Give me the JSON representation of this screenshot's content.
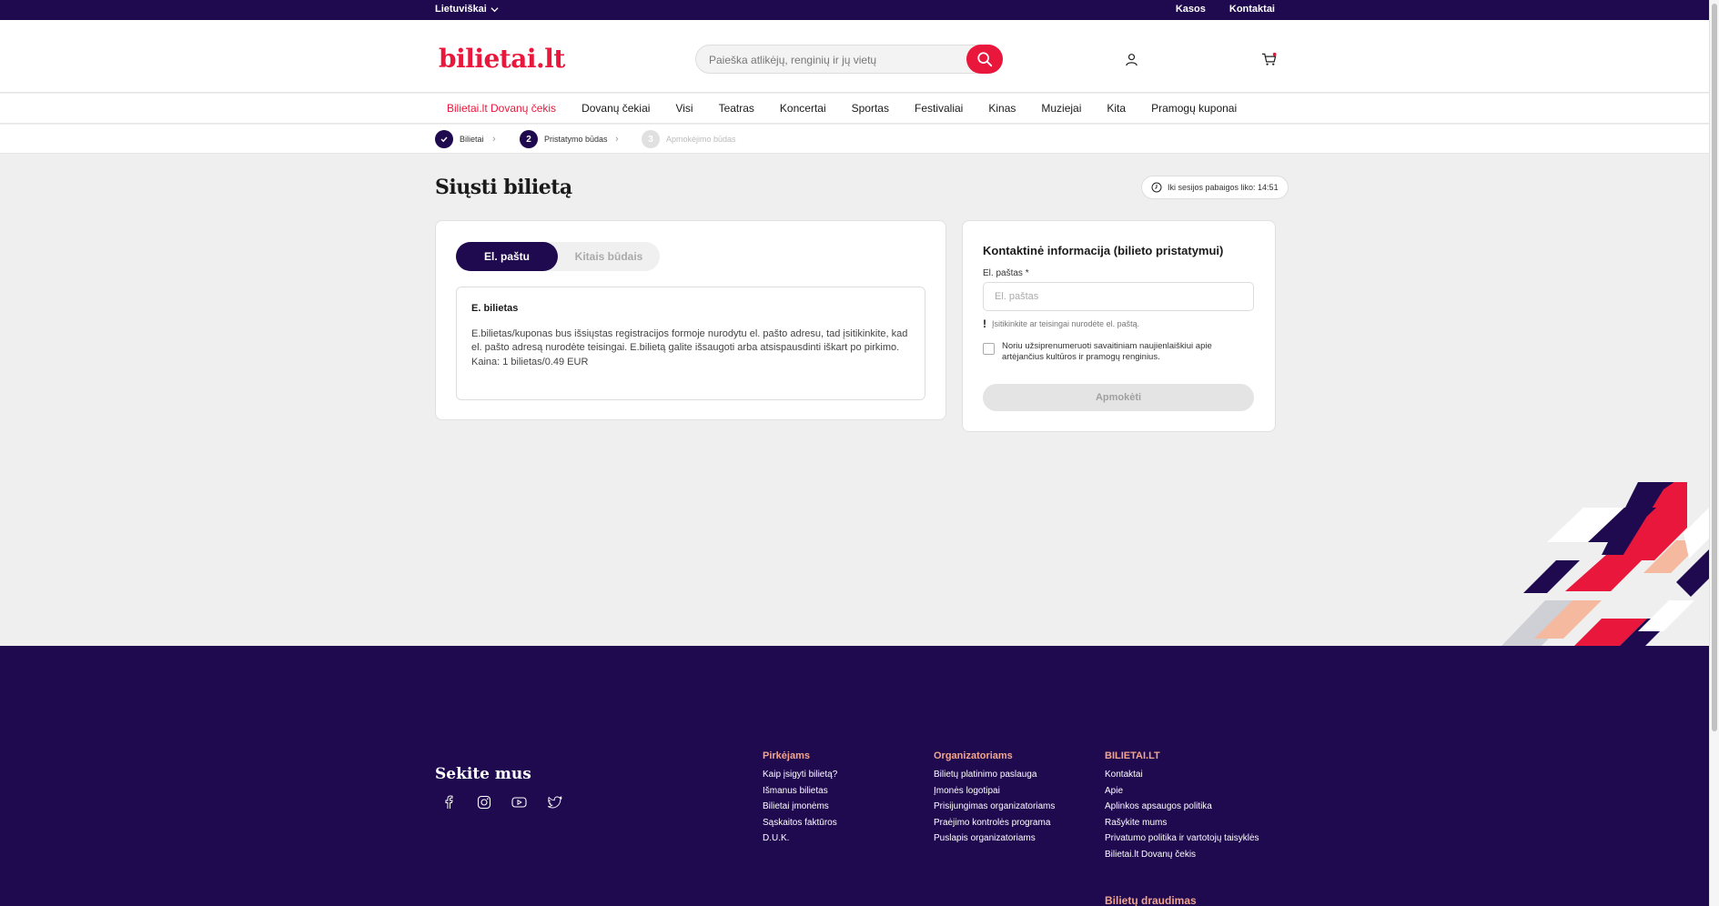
{
  "topbar": {
    "language": "Lietuviškai",
    "links": [
      "Kasos",
      "Kontaktai"
    ]
  },
  "header": {
    "logo": "bilietai.lt",
    "search_placeholder": "Paieška atlikėjų, renginių ir jų vietų"
  },
  "nav": {
    "items": [
      "Bilietai.lt Dovanų čekis",
      "Dovanų čekiai",
      "Visi",
      "Teatras",
      "Koncertai",
      "Sportas",
      "Festivaliai",
      "Kinas",
      "Muziejai",
      "Kita",
      "Pramogų kuponai"
    ]
  },
  "stepper": {
    "steps": [
      {
        "num": "",
        "label": "Bilietai"
      },
      {
        "num": "2",
        "label": "Pristatymo būdas"
      },
      {
        "num": "3",
        "label": "Apmokėjimo būdas"
      }
    ]
  },
  "page": {
    "title": "Siųsti bilietą",
    "timer": "Iki sesijos pabaigos liko: 14:51"
  },
  "delivery": {
    "tabs": [
      "El. paštu",
      "Kitais būdais"
    ],
    "box_title": "E. bilietas",
    "box_text": "E.bilietas/kuponas bus išsiųstas registracijos formoje nurodytu el. pašto adresu, tad įsitikinkite, kad el. pašto adresą nurodėte teisingai. E.bilietą galite išsaugoti arba atsispausdinti iškart po pirkimo.",
    "price": "Kaina: 1 bilietas/0.49 EUR"
  },
  "contact": {
    "title": "Kontaktinė informacija (bilieto pristatymui)",
    "email_label": "El. paštas *",
    "email_placeholder": "El. paštas",
    "warning": "Įsitikinkite ar teisingai nurodėte el. paštą.",
    "subscribe": "Noriu užsiprenumeruoti savaitiniam naujienlaiškiui apie artėjančius kultūros ir pramogų renginius.",
    "pay_button": "Apmokėti"
  },
  "footer": {
    "follow": "Sekite mus",
    "socials": [
      "facebook-icon",
      "instagram-icon",
      "youtube-icon",
      "twitter-icon"
    ],
    "columns": [
      {
        "heading": "Pirkėjams",
        "links": [
          "Kaip įsigyti bilietą?",
          "Išmanus bilietas",
          "Bilietai įmonėms",
          "Sąskaitos faktūros",
          "D.U.K."
        ]
      },
      {
        "heading": "Organizatoriams",
        "links": [
          "Bilietų platinimo paslauga",
          "Įmonės logotipai",
          "Prisijungimas organizatoriams",
          "Praėjimo kontrolės programa",
          "Puslapis organizatoriams"
        ]
      },
      {
        "heading": "BILIETAI.LT",
        "links": [
          "Kontaktai",
          "Apie",
          "Aplinkos apsaugos politika",
          "Rašykite mums",
          "Privatumo politika ir vartotojų taisyklės",
          "Bilietai.lt Dovanų čekis"
        ]
      }
    ],
    "insurance": "Bilietų draudimas"
  },
  "colors": {
    "brand_red": "#e8173b",
    "navy": "#1f0a4f",
    "peach": "#f2a58c"
  }
}
